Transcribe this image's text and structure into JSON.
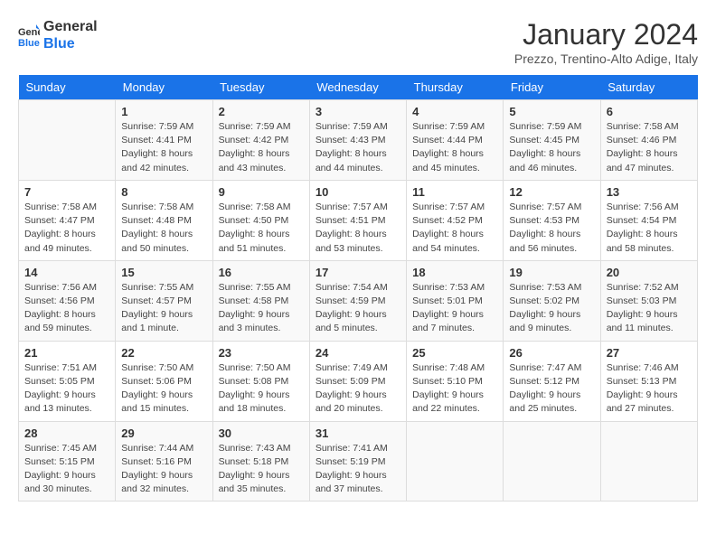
{
  "header": {
    "logo_line1": "General",
    "logo_line2": "Blue",
    "month": "January 2024",
    "location": "Prezzo, Trentino-Alto Adige, Italy"
  },
  "days_of_week": [
    "Sunday",
    "Monday",
    "Tuesday",
    "Wednesday",
    "Thursday",
    "Friday",
    "Saturday"
  ],
  "weeks": [
    [
      {
        "day": "",
        "sunrise": "",
        "sunset": "",
        "daylight": ""
      },
      {
        "day": "1",
        "sunrise": "7:59 AM",
        "sunset": "4:41 PM",
        "daylight": "8 hours and 42 minutes."
      },
      {
        "day": "2",
        "sunrise": "7:59 AM",
        "sunset": "4:42 PM",
        "daylight": "8 hours and 43 minutes."
      },
      {
        "day": "3",
        "sunrise": "7:59 AM",
        "sunset": "4:43 PM",
        "daylight": "8 hours and 44 minutes."
      },
      {
        "day": "4",
        "sunrise": "7:59 AM",
        "sunset": "4:44 PM",
        "daylight": "8 hours and 45 minutes."
      },
      {
        "day": "5",
        "sunrise": "7:59 AM",
        "sunset": "4:45 PM",
        "daylight": "8 hours and 46 minutes."
      },
      {
        "day": "6",
        "sunrise": "7:58 AM",
        "sunset": "4:46 PM",
        "daylight": "8 hours and 47 minutes."
      }
    ],
    [
      {
        "day": "7",
        "sunrise": "7:58 AM",
        "sunset": "4:47 PM",
        "daylight": "8 hours and 49 minutes."
      },
      {
        "day": "8",
        "sunrise": "7:58 AM",
        "sunset": "4:48 PM",
        "daylight": "8 hours and 50 minutes."
      },
      {
        "day": "9",
        "sunrise": "7:58 AM",
        "sunset": "4:50 PM",
        "daylight": "8 hours and 51 minutes."
      },
      {
        "day": "10",
        "sunrise": "7:57 AM",
        "sunset": "4:51 PM",
        "daylight": "8 hours and 53 minutes."
      },
      {
        "day": "11",
        "sunrise": "7:57 AM",
        "sunset": "4:52 PM",
        "daylight": "8 hours and 54 minutes."
      },
      {
        "day": "12",
        "sunrise": "7:57 AM",
        "sunset": "4:53 PM",
        "daylight": "8 hours and 56 minutes."
      },
      {
        "day": "13",
        "sunrise": "7:56 AM",
        "sunset": "4:54 PM",
        "daylight": "8 hours and 58 minutes."
      }
    ],
    [
      {
        "day": "14",
        "sunrise": "7:56 AM",
        "sunset": "4:56 PM",
        "daylight": "8 hours and 59 minutes."
      },
      {
        "day": "15",
        "sunrise": "7:55 AM",
        "sunset": "4:57 PM",
        "daylight": "9 hours and 1 minute."
      },
      {
        "day": "16",
        "sunrise": "7:55 AM",
        "sunset": "4:58 PM",
        "daylight": "9 hours and 3 minutes."
      },
      {
        "day": "17",
        "sunrise": "7:54 AM",
        "sunset": "4:59 PM",
        "daylight": "9 hours and 5 minutes."
      },
      {
        "day": "18",
        "sunrise": "7:53 AM",
        "sunset": "5:01 PM",
        "daylight": "9 hours and 7 minutes."
      },
      {
        "day": "19",
        "sunrise": "7:53 AM",
        "sunset": "5:02 PM",
        "daylight": "9 hours and 9 minutes."
      },
      {
        "day": "20",
        "sunrise": "7:52 AM",
        "sunset": "5:03 PM",
        "daylight": "9 hours and 11 minutes."
      }
    ],
    [
      {
        "day": "21",
        "sunrise": "7:51 AM",
        "sunset": "5:05 PM",
        "daylight": "9 hours and 13 minutes."
      },
      {
        "day": "22",
        "sunrise": "7:50 AM",
        "sunset": "5:06 PM",
        "daylight": "9 hours and 15 minutes."
      },
      {
        "day": "23",
        "sunrise": "7:50 AM",
        "sunset": "5:08 PM",
        "daylight": "9 hours and 18 minutes."
      },
      {
        "day": "24",
        "sunrise": "7:49 AM",
        "sunset": "5:09 PM",
        "daylight": "9 hours and 20 minutes."
      },
      {
        "day": "25",
        "sunrise": "7:48 AM",
        "sunset": "5:10 PM",
        "daylight": "9 hours and 22 minutes."
      },
      {
        "day": "26",
        "sunrise": "7:47 AM",
        "sunset": "5:12 PM",
        "daylight": "9 hours and 25 minutes."
      },
      {
        "day": "27",
        "sunrise": "7:46 AM",
        "sunset": "5:13 PM",
        "daylight": "9 hours and 27 minutes."
      }
    ],
    [
      {
        "day": "28",
        "sunrise": "7:45 AM",
        "sunset": "5:15 PM",
        "daylight": "9 hours and 30 minutes."
      },
      {
        "day": "29",
        "sunrise": "7:44 AM",
        "sunset": "5:16 PM",
        "daylight": "9 hours and 32 minutes."
      },
      {
        "day": "30",
        "sunrise": "7:43 AM",
        "sunset": "5:18 PM",
        "daylight": "9 hours and 35 minutes."
      },
      {
        "day": "31",
        "sunrise": "7:41 AM",
        "sunset": "5:19 PM",
        "daylight": "9 hours and 37 minutes."
      },
      {
        "day": "",
        "sunrise": "",
        "sunset": "",
        "daylight": ""
      },
      {
        "day": "",
        "sunrise": "",
        "sunset": "",
        "daylight": ""
      },
      {
        "day": "",
        "sunrise": "",
        "sunset": "",
        "daylight": ""
      }
    ]
  ],
  "labels": {
    "sunrise": "Sunrise:",
    "sunset": "Sunset:",
    "daylight": "Daylight:"
  }
}
